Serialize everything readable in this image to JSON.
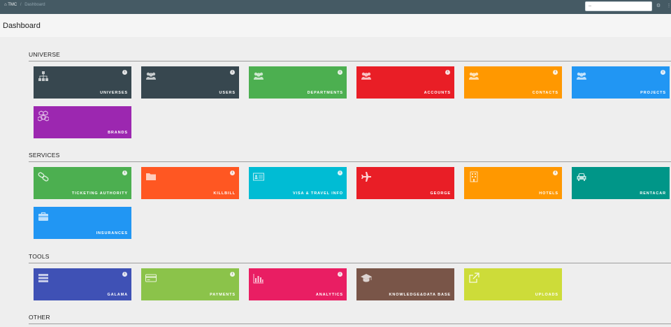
{
  "breadcrumb": {
    "home": "TMC",
    "current": "Dashboard"
  },
  "search": {
    "value": "--"
  },
  "page": {
    "title": "Dashboard"
  },
  "sections": {
    "universe": {
      "title": "UNIVERSE",
      "tiles": [
        {
          "label": "UNIVERSES",
          "color": "#37474f",
          "icon": "sitemap-icon"
        },
        {
          "label": "USERS",
          "color": "#37474f",
          "icon": "users-icon"
        },
        {
          "label": "DEPARTMENTS",
          "color": "#4caf50",
          "icon": "users-icon"
        },
        {
          "label": "ACCOUNTS",
          "color": "#e91e26",
          "icon": "users-icon"
        },
        {
          "label": "CONTACTS",
          "color": "#ff9800",
          "icon": "users-icon"
        },
        {
          "label": "PROJECTS",
          "color": "#2196f3",
          "icon": "users-icon"
        },
        {
          "label": "BRANDS",
          "color": "#9c27b0",
          "icon": "cubes-icon"
        }
      ]
    },
    "services": {
      "title": "SERVICES",
      "tiles": [
        {
          "label": "TICKETING AUTHORITY",
          "color": "#4caf50",
          "icon": "chain-link-icon"
        },
        {
          "label": "KILLBILL",
          "color": "#ff5722",
          "icon": "folder-icon"
        },
        {
          "label": "VISA & TRAVEL INFO",
          "color": "#00bcd4",
          "icon": "id-card-icon"
        },
        {
          "label": "GEORGE",
          "color": "#e91e26",
          "icon": "airplane-icon"
        },
        {
          "label": "HOTELS",
          "color": "#ff9800",
          "icon": "building-icon"
        },
        {
          "label": "RENTACAR",
          "color": "#009688",
          "icon": "car-icon"
        },
        {
          "label": "INSURANCES",
          "color": "#2196f3",
          "icon": "briefcase-icon"
        }
      ]
    },
    "tools": {
      "title": "TOOLS",
      "tiles": [
        {
          "label": "GALAMA",
          "color": "#3f51b5",
          "icon": "list-icon"
        },
        {
          "label": "PAYMENTS",
          "color": "#8bc34a",
          "icon": "credit-card-icon"
        },
        {
          "label": "ANALYTICS",
          "color": "#e91e63",
          "icon": "bar-chart-icon"
        },
        {
          "label": "KNOWLEDGE&DATA BASE",
          "color": "#795548",
          "icon": "graduation-cap-icon"
        },
        {
          "label": "UPLOADS",
          "color": "#cddc39",
          "icon": "external-link-icon"
        }
      ]
    },
    "other": {
      "title": "OTHER"
    }
  }
}
